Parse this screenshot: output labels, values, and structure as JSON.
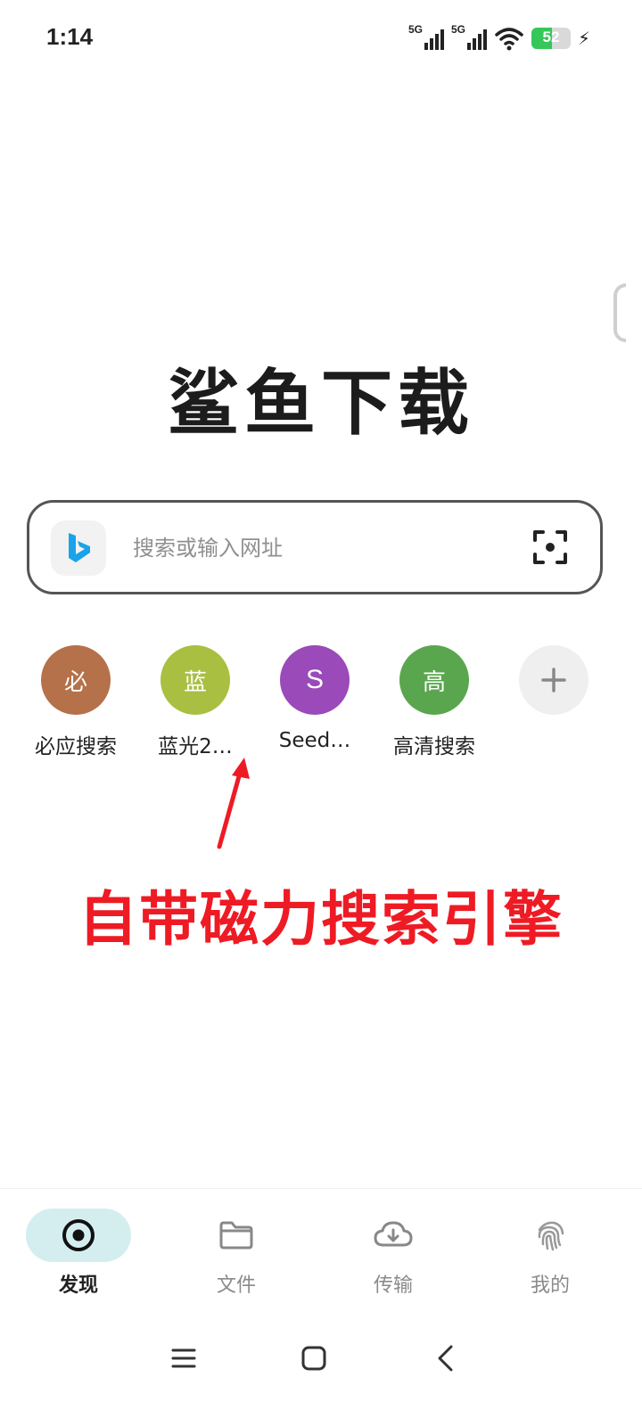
{
  "status_bar": {
    "time": "1:14",
    "signal_1": "5G",
    "signal_2": "5G",
    "battery": "52",
    "battery_level": 0.52
  },
  "app": {
    "title": "鲨鱼下载"
  },
  "search": {
    "placeholder": "搜索或输入网址",
    "engine_icon": "bing-icon",
    "scan_icon": "scan-icon"
  },
  "shortcuts": [
    {
      "glyph": "必",
      "label": "必应搜索",
      "color": "#b5714a"
    },
    {
      "glyph": "蓝",
      "label": "蓝光2…",
      "color": "#a9bf41"
    },
    {
      "glyph": "S",
      "label": "Seed…",
      "color": "#9a4ab9"
    },
    {
      "glyph": "高",
      "label": "高清搜索",
      "color": "#5aa64e"
    }
  ],
  "add_shortcut_icon": "plus-icon",
  "annotation": {
    "text": "自带磁力搜索引擎",
    "color": "#ee1b24"
  },
  "bottom_nav": [
    {
      "label": "发现",
      "icon": "discover-icon",
      "active": true
    },
    {
      "label": "文件",
      "icon": "folder-icon",
      "active": false
    },
    {
      "label": "传输",
      "icon": "cloud-download-icon",
      "active": false
    },
    {
      "label": "我的",
      "icon": "fingerprint-icon",
      "active": false
    }
  ],
  "colors": {
    "accent": "#d4eef0",
    "bing_blue": "#1aa3e8"
  }
}
